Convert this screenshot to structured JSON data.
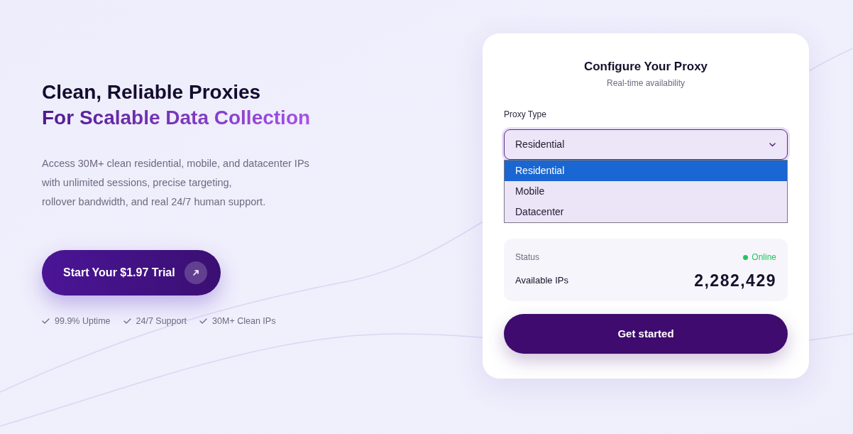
{
  "hero": {
    "title": "Clean, Reliable Proxies",
    "highlight": "For Scalable Data Collection",
    "description": [
      "Access 30M+ clean residential, mobile, and datacenter IPs",
      "with unlimited sessions, precise targeting,",
      "rollover bandwidth, and real 24/7 human support."
    ],
    "cta": "Start Your $1.97 Trial",
    "features": [
      "99.9% Uptime",
      "24/7 Support",
      "30M+ Clean IPs"
    ]
  },
  "card": {
    "title": "Configure Your Proxy",
    "subtitle": "Real-time availability",
    "proxy_type": {
      "label": "Proxy Type",
      "value": "Residential",
      "expanded": true,
      "options": [
        {
          "label": "Residential",
          "selected": true
        },
        {
          "label": "Mobile",
          "selected": false
        },
        {
          "label": "Datacenter",
          "selected": false
        }
      ]
    },
    "status": {
      "label": "Status",
      "value": "Online"
    },
    "available_ips": {
      "label": "Available IPs",
      "value": "2,282,429"
    },
    "button": "Get started"
  }
}
